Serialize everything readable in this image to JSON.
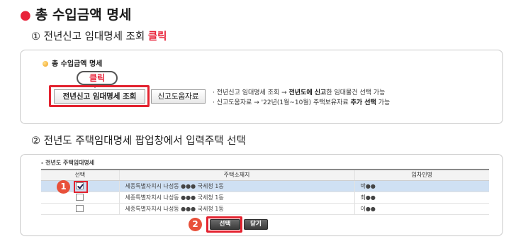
{
  "heading": "총 수입금액 명세",
  "steps": {
    "step1_prefix": "① 전년신고 임대명세 조회",
    "step1_accent": "클릭",
    "step2": "② 전년도 주택임대명세 팝업창에서 입력주택 선택"
  },
  "panel1": {
    "title": "총 수입금액 명세",
    "callout": "클릭",
    "lookup_button": "전년신고 임대명세 조회",
    "docs_button": "신고도움자료",
    "note1_a": "· 전년신고 임대명세 조회 → ",
    "note1_b": "전년도에 신고",
    "note1_c": "한 임대물건 선택 가능",
    "note2_a": "· 신고도움자료 → '22년(1월~10월) 주택보유자료 ",
    "note2_b": "추가 선택",
    "note2_c": " 가능"
  },
  "panel2": {
    "title": "- 전년도 주택임대명세",
    "columns": [
      "선택",
      "주택소재지",
      "임차인명"
    ],
    "rows": [
      {
        "selected": true,
        "address": "세종특별자치시 나성동 ●●● 국세청 1동",
        "tenant": "박●●"
      },
      {
        "selected": false,
        "address": "세종특별자치시 나성동 ●●● 국세청 1동",
        "tenant": "최●●"
      },
      {
        "selected": false,
        "address": "세종특별자치시 나성동 ●●● 국세청 1동",
        "tenant": "이●●"
      }
    ],
    "select_button": "선택",
    "close_button": "닫기"
  },
  "markers": {
    "one": "1",
    "two": "2"
  },
  "colors": {
    "accent": "#e8233a",
    "highlight_row": "#cfe0f3",
    "frame": "#e3222f"
  }
}
